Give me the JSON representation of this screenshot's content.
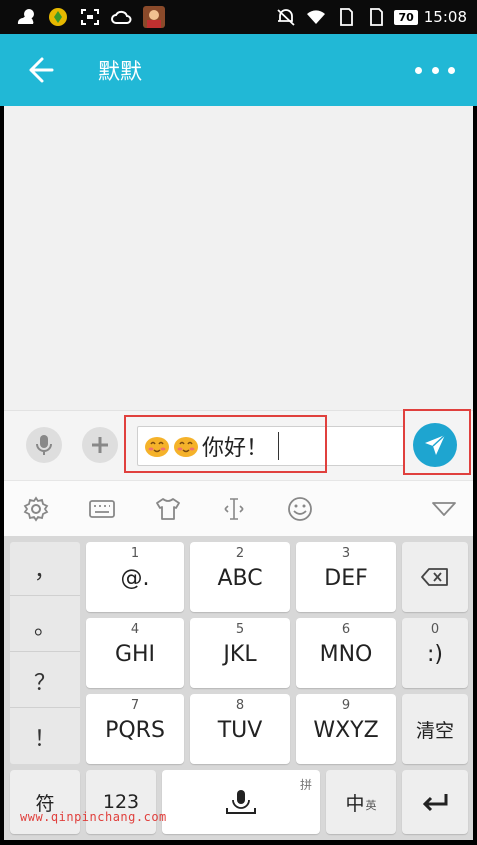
{
  "status_bar": {
    "time": "15:08",
    "battery": "70",
    "left_icons": [
      "weather-icon",
      "game-app-icon",
      "screenshot-icon",
      "cloud-icon",
      "avatar-app-icon"
    ],
    "right_icons": [
      "mute-icon",
      "wifi-icon",
      "sim1-icon",
      "sim2-icon"
    ]
  },
  "app_bar": {
    "title": "默默",
    "color": "#21b8d6"
  },
  "input_bar": {
    "text": "你好！",
    "emoji_count": 2,
    "send_color": "#1ea5d0"
  },
  "keyboard_toolbar": {
    "icons": [
      "gear-icon",
      "keyboard-icon",
      "skin-icon",
      "cursor-icon",
      "emoji-icon",
      "collapse-icon"
    ]
  },
  "keyboard": {
    "side_symbols": [
      "，",
      "。",
      "？",
      "！"
    ],
    "keys": [
      {
        "num": "1",
        "label": "@."
      },
      {
        "num": "2",
        "label": "ABC"
      },
      {
        "num": "3",
        "label": "DEF"
      },
      {
        "num": "4",
        "label": "GHI"
      },
      {
        "num": "5",
        "label": "JKL"
      },
      {
        "num": "6",
        "label": "MNO"
      },
      {
        "num": "7",
        "label": "PQRS"
      },
      {
        "num": "8",
        "label": "TUV"
      },
      {
        "num": "9",
        "label": "WXYZ"
      }
    ],
    "zero_num": "0",
    "zero_label": ":)",
    "clear_label": "清空",
    "symbols_label": "符",
    "numbers_label": "123",
    "space_tag": "拼",
    "lang_main": "中",
    "lang_sub": "英"
  },
  "watermark": "www.qinpinchang.com",
  "colors": {
    "highlight_box": "#e0403d"
  }
}
